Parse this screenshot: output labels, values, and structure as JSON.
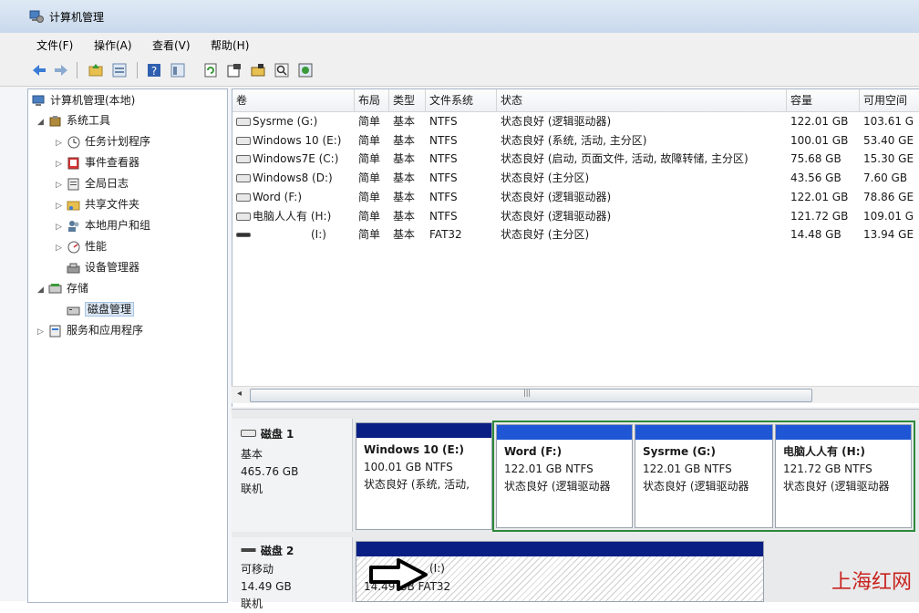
{
  "window": {
    "title": "计算机管理"
  },
  "menu": [
    "文件(F)",
    "操作(A)",
    "查看(V)",
    "帮助(H)"
  ],
  "toolbar_icons": [
    "back-arrow-icon",
    "forward-arrow-icon",
    "folder-up-icon",
    "view-icon",
    "help-icon",
    "panel-icon",
    "refresh-icon",
    "properties-icon",
    "open-icon",
    "search-icon",
    "settings-icon"
  ],
  "tree": [
    {
      "label": "计算机管理(本地)",
      "indent": 0,
      "exp": "",
      "icon": "computer"
    },
    {
      "label": "系统工具",
      "indent": 1,
      "exp": "◢",
      "icon": "tools"
    },
    {
      "label": "任务计划程序",
      "indent": 2,
      "exp": "▷",
      "icon": "clock"
    },
    {
      "label": "事件查看器",
      "indent": 2,
      "exp": "▷",
      "icon": "event"
    },
    {
      "label": "全局日志",
      "indent": 2,
      "exp": "▷",
      "icon": "log"
    },
    {
      "label": "共享文件夹",
      "indent": 2,
      "exp": "▷",
      "icon": "folder"
    },
    {
      "label": "本地用户和组",
      "indent": 2,
      "exp": "▷",
      "icon": "users"
    },
    {
      "label": "性能",
      "indent": 2,
      "exp": "▷",
      "icon": "perf"
    },
    {
      "label": "设备管理器",
      "indent": 2,
      "exp": "",
      "icon": "device"
    },
    {
      "label": "存储",
      "indent": 1,
      "exp": "◢",
      "icon": "storage"
    },
    {
      "label": "磁盘管理",
      "indent": 2,
      "exp": "",
      "icon": "disk",
      "selected": true
    },
    {
      "label": "服务和应用程序",
      "indent": 1,
      "exp": "▷",
      "icon": "services"
    }
  ],
  "volume_columns": [
    "卷",
    "布局",
    "类型",
    "文件系统",
    "状态",
    "容量",
    "可用空间"
  ],
  "volumes": [
    [
      "Sysrme (G:)",
      "简单",
      "基本",
      "NTFS",
      "状态良好 (逻辑驱动器)",
      "122.01 GB",
      "103.61 G"
    ],
    [
      "Windows 10 (E:)",
      "简单",
      "基本",
      "NTFS",
      "状态良好 (系统, 活动, 主分区)",
      "100.01 GB",
      "53.40 GE"
    ],
    [
      "Windows7E (C:)",
      "简单",
      "基本",
      "NTFS",
      "状态良好 (启动, 页面文件, 活动, 故障转储, 主分区)",
      "75.68 GB",
      "15.30 GE"
    ],
    [
      "Windows8 (D:)",
      "简单",
      "基本",
      "NTFS",
      "状态良好 (主分区)",
      "43.56 GB",
      "7.60 GB"
    ],
    [
      "Word (F:)",
      "简单",
      "基本",
      "NTFS",
      "状态良好 (逻辑驱动器)",
      "122.01 GB",
      "78.86 GE"
    ],
    [
      "电脑人人有 (H:)",
      "简单",
      "基本",
      "NTFS",
      "状态良好 (逻辑驱动器)",
      "121.72 GB",
      "109.01 G"
    ],
    [
      "(I:)",
      "简单",
      "基本",
      "FAT32",
      "状态良好 (主分区)",
      "14.48 GB",
      "13.94 GE"
    ]
  ],
  "disks": {
    "disk1": {
      "name": "磁盘 1",
      "type": "基本",
      "size": "465.76 GB",
      "status": "联机",
      "partitions": [
        {
          "title": "Windows 10  (E:)",
          "line1": "100.01 GB NTFS",
          "line2": "状态良好 (系统, 活动,"
        },
        {
          "title": "Word  (F:)",
          "line1": "122.01 GB NTFS",
          "line2": "状态良好 (逻辑驱动器"
        },
        {
          "title": "Sysrme  (G:)",
          "line1": "122.01 GB NTFS",
          "line2": "状态良好 (逻辑驱动器"
        },
        {
          "title": "电脑人人有  (H:)",
          "line1": "121.72 GB NTFS",
          "line2": "状态良好 (逻辑驱动器"
        }
      ]
    },
    "disk2": {
      "name": "磁盘 2",
      "type": "可移动",
      "size": "14.49 GB",
      "status": "联机",
      "partitions": [
        {
          "title": "(I:)",
          "line1": "14.49 GB FAT32"
        }
      ]
    }
  },
  "watermark": "上海红网"
}
